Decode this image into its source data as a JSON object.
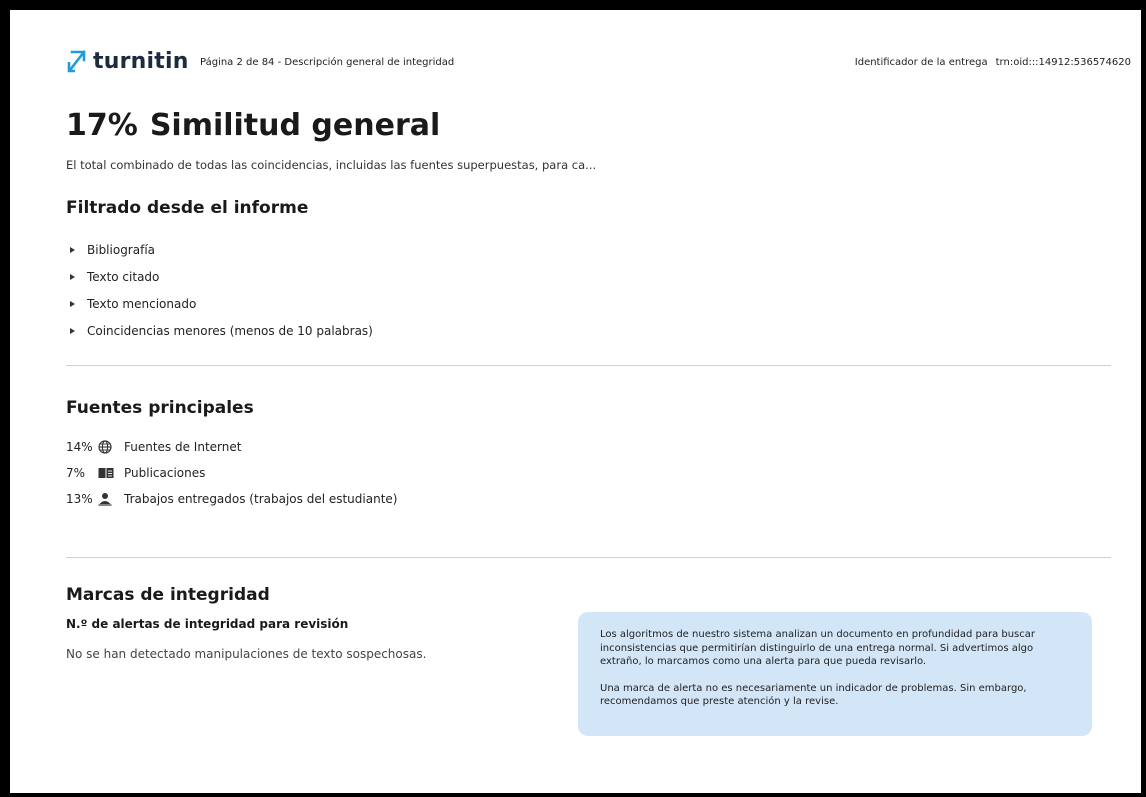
{
  "header": {
    "logo_text": "turnitin",
    "page_info": "Página 2 de 84 - Descripción general de integridad",
    "submission_label": "Identificador de la entrega",
    "submission_id": "trn:oid:::14912:536574620"
  },
  "summary": {
    "percent": "17%",
    "title": "Similitud general",
    "description": "El total combinado de todas las coincidencias, incluidas las fuentes superpuestas, para ca..."
  },
  "filters": {
    "heading": "Filtrado desde el informe",
    "items": [
      {
        "label": "Bibliografía"
      },
      {
        "label": "Texto citado"
      },
      {
        "label": "Texto mencionado"
      },
      {
        "label": "Coincidencias menores (menos de 10 palabras)"
      }
    ]
  },
  "sources": {
    "heading": "Fuentes principales",
    "items": [
      {
        "percent": "14%",
        "icon": "globe-icon",
        "label": "Fuentes de Internet"
      },
      {
        "percent": "7%",
        "icon": "book-icon",
        "label": "Publicaciones"
      },
      {
        "percent": "13%",
        "icon": "person-icon",
        "label": "Trabajos entregados (trabajos del estudiante)"
      }
    ]
  },
  "integrity": {
    "heading": "Marcas de integridad",
    "alerts_label": "N.º de alertas de integridad para revisión",
    "status": "No se han detectado manipulaciones de texto sospechosas.",
    "info_p1": "Los algoritmos de nuestro sistema analizan un documento en profundidad para buscar inconsistencias que permitirían distinguirlo de una entrega normal. Si advertimos algo extraño, lo marcamos como una alerta para que pueda revisarlo.",
    "info_p2": "Una marca de alerta no es necesariamente un indicador de problemas. Sin embargo, recomendamos que preste atención y la revise."
  },
  "colors": {
    "logo_accent": "#1f9bde",
    "info_box_bg": "#d3e6f7"
  }
}
